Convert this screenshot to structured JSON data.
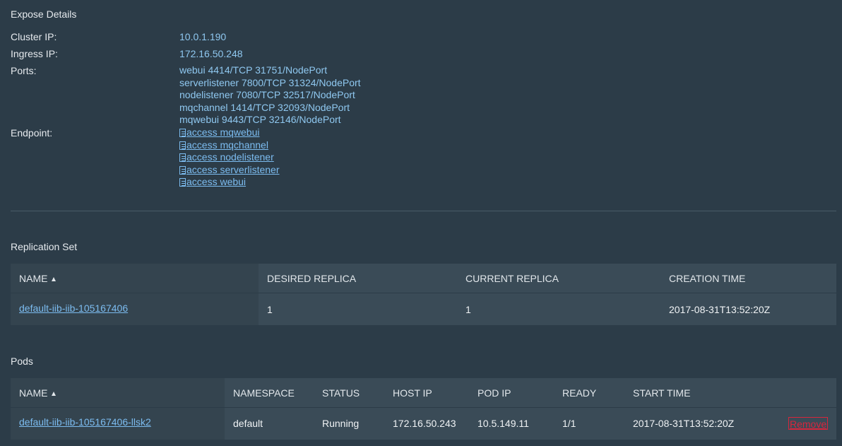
{
  "expose": {
    "title": "Expose Details",
    "cluster_ip_label": "Cluster IP:",
    "cluster_ip": "10.0.1.190",
    "ingress_ip_label": "Ingress IP:",
    "ingress_ip": "172.16.50.248",
    "ports_label": "Ports:",
    "ports": [
      "webui 4414/TCP 31751/NodePort",
      "serverlistener 7800/TCP 31324/NodePort",
      "nodelistener 7080/TCP 32517/NodePort",
      "mqchannel 1414/TCP 32093/NodePort",
      "mqwebui 9443/TCP 32146/NodePort"
    ],
    "endpoint_label": "Endpoint:",
    "endpoints": [
      "access mqwebui",
      "access mqchannel",
      "access nodelistener",
      "access serverlistener",
      "access webui"
    ],
    "endpoint_icon": "document-icon"
  },
  "replication_set": {
    "title": "Replication Set",
    "headers": {
      "name": "NAME",
      "desired": "DESIRED REPLICA",
      "current": "CURRENT REPLICA",
      "created": "CREATION TIME"
    },
    "row": {
      "name": "default-iib-iib-105167406",
      "desired": "1",
      "current": "1",
      "created": "2017-08-31T13:52:20Z"
    }
  },
  "pods": {
    "title": "Pods",
    "headers": {
      "name": "NAME",
      "namespace": "NAMESPACE",
      "status": "STATUS",
      "host_ip": "HOST IP",
      "pod_ip": "POD IP",
      "ready": "READY",
      "start_time": "START TIME"
    },
    "row": {
      "name": "default-iib-iib-105167406-llsk2",
      "namespace": "default",
      "status": "Running",
      "host_ip": "172.16.50.243",
      "pod_ip": "10.5.149.11",
      "ready": "1/1",
      "start_time": "2017-08-31T13:52:20Z",
      "remove_label": "Remove"
    }
  },
  "colors": {
    "background": "#2c3c48",
    "link": "#7cbcf0",
    "value": "#8fc8f0",
    "table_bg": "#3a4b57",
    "remove": "#d7263d"
  }
}
